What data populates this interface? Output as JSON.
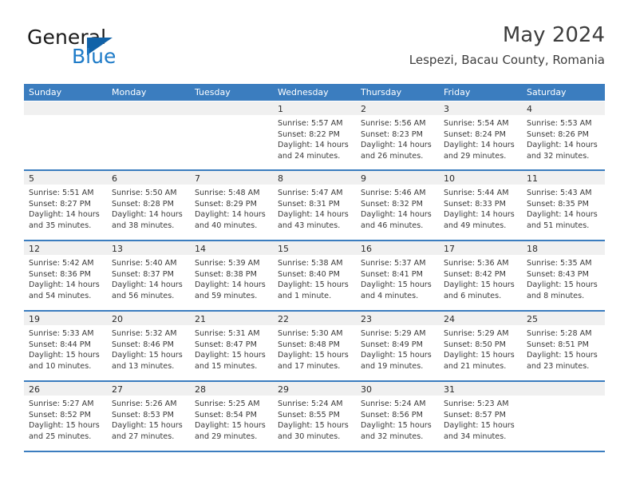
{
  "brand": {
    "name_part1": "General",
    "name_part2": "Blue",
    "accent_color": "#1e7bc8",
    "triangle_color": "#1162a8"
  },
  "header": {
    "title": "May 2024",
    "subtitle": "Lespezi, Bacau County, Romania"
  },
  "theme": {
    "header_bg": "#3b7dbf",
    "header_text": "#ffffff",
    "day_band_bg": "#f0f0f0",
    "cell_bg": "#ffffff",
    "row_divider": "#3b7dbf"
  },
  "weekdays": [
    "Sunday",
    "Monday",
    "Tuesday",
    "Wednesday",
    "Thursday",
    "Friday",
    "Saturday"
  ],
  "labels": {
    "sunrise_prefix": "Sunrise:",
    "sunset_prefix": "Sunset:",
    "daylight_prefix": "Daylight:"
  },
  "weeks": [
    [
      {
        "day": "",
        "l1": "",
        "l2": "",
        "l3": "",
        "l4": ""
      },
      {
        "day": "",
        "l1": "",
        "l2": "",
        "l3": "",
        "l4": ""
      },
      {
        "day": "",
        "l1": "",
        "l2": "",
        "l3": "",
        "l4": ""
      },
      {
        "day": "1",
        "l1": "Sunrise: 5:57 AM",
        "l2": "Sunset: 8:22 PM",
        "l3": "Daylight: 14 hours",
        "l4": "and 24 minutes."
      },
      {
        "day": "2",
        "l1": "Sunrise: 5:56 AM",
        "l2": "Sunset: 8:23 PM",
        "l3": "Daylight: 14 hours",
        "l4": "and 26 minutes."
      },
      {
        "day": "3",
        "l1": "Sunrise: 5:54 AM",
        "l2": "Sunset: 8:24 PM",
        "l3": "Daylight: 14 hours",
        "l4": "and 29 minutes."
      },
      {
        "day": "4",
        "l1": "Sunrise: 5:53 AM",
        "l2": "Sunset: 8:26 PM",
        "l3": "Daylight: 14 hours",
        "l4": "and 32 minutes."
      }
    ],
    [
      {
        "day": "5",
        "l1": "Sunrise: 5:51 AM",
        "l2": "Sunset: 8:27 PM",
        "l3": "Daylight: 14 hours",
        "l4": "and 35 minutes."
      },
      {
        "day": "6",
        "l1": "Sunrise: 5:50 AM",
        "l2": "Sunset: 8:28 PM",
        "l3": "Daylight: 14 hours",
        "l4": "and 38 minutes."
      },
      {
        "day": "7",
        "l1": "Sunrise: 5:48 AM",
        "l2": "Sunset: 8:29 PM",
        "l3": "Daylight: 14 hours",
        "l4": "and 40 minutes."
      },
      {
        "day": "8",
        "l1": "Sunrise: 5:47 AM",
        "l2": "Sunset: 8:31 PM",
        "l3": "Daylight: 14 hours",
        "l4": "and 43 minutes."
      },
      {
        "day": "9",
        "l1": "Sunrise: 5:46 AM",
        "l2": "Sunset: 8:32 PM",
        "l3": "Daylight: 14 hours",
        "l4": "and 46 minutes."
      },
      {
        "day": "10",
        "l1": "Sunrise: 5:44 AM",
        "l2": "Sunset: 8:33 PM",
        "l3": "Daylight: 14 hours",
        "l4": "and 49 minutes."
      },
      {
        "day": "11",
        "l1": "Sunrise: 5:43 AM",
        "l2": "Sunset: 8:35 PM",
        "l3": "Daylight: 14 hours",
        "l4": "and 51 minutes."
      }
    ],
    [
      {
        "day": "12",
        "l1": "Sunrise: 5:42 AM",
        "l2": "Sunset: 8:36 PM",
        "l3": "Daylight: 14 hours",
        "l4": "and 54 minutes."
      },
      {
        "day": "13",
        "l1": "Sunrise: 5:40 AM",
        "l2": "Sunset: 8:37 PM",
        "l3": "Daylight: 14 hours",
        "l4": "and 56 minutes."
      },
      {
        "day": "14",
        "l1": "Sunrise: 5:39 AM",
        "l2": "Sunset: 8:38 PM",
        "l3": "Daylight: 14 hours",
        "l4": "and 59 minutes."
      },
      {
        "day": "15",
        "l1": "Sunrise: 5:38 AM",
        "l2": "Sunset: 8:40 PM",
        "l3": "Daylight: 15 hours",
        "l4": "and 1 minute."
      },
      {
        "day": "16",
        "l1": "Sunrise: 5:37 AM",
        "l2": "Sunset: 8:41 PM",
        "l3": "Daylight: 15 hours",
        "l4": "and 4 minutes."
      },
      {
        "day": "17",
        "l1": "Sunrise: 5:36 AM",
        "l2": "Sunset: 8:42 PM",
        "l3": "Daylight: 15 hours",
        "l4": "and 6 minutes."
      },
      {
        "day": "18",
        "l1": "Sunrise: 5:35 AM",
        "l2": "Sunset: 8:43 PM",
        "l3": "Daylight: 15 hours",
        "l4": "and 8 minutes."
      }
    ],
    [
      {
        "day": "19",
        "l1": "Sunrise: 5:33 AM",
        "l2": "Sunset: 8:44 PM",
        "l3": "Daylight: 15 hours",
        "l4": "and 10 minutes."
      },
      {
        "day": "20",
        "l1": "Sunrise: 5:32 AM",
        "l2": "Sunset: 8:46 PM",
        "l3": "Daylight: 15 hours",
        "l4": "and 13 minutes."
      },
      {
        "day": "21",
        "l1": "Sunrise: 5:31 AM",
        "l2": "Sunset: 8:47 PM",
        "l3": "Daylight: 15 hours",
        "l4": "and 15 minutes."
      },
      {
        "day": "22",
        "l1": "Sunrise: 5:30 AM",
        "l2": "Sunset: 8:48 PM",
        "l3": "Daylight: 15 hours",
        "l4": "and 17 minutes."
      },
      {
        "day": "23",
        "l1": "Sunrise: 5:29 AM",
        "l2": "Sunset: 8:49 PM",
        "l3": "Daylight: 15 hours",
        "l4": "and 19 minutes."
      },
      {
        "day": "24",
        "l1": "Sunrise: 5:29 AM",
        "l2": "Sunset: 8:50 PM",
        "l3": "Daylight: 15 hours",
        "l4": "and 21 minutes."
      },
      {
        "day": "25",
        "l1": "Sunrise: 5:28 AM",
        "l2": "Sunset: 8:51 PM",
        "l3": "Daylight: 15 hours",
        "l4": "and 23 minutes."
      }
    ],
    [
      {
        "day": "26",
        "l1": "Sunrise: 5:27 AM",
        "l2": "Sunset: 8:52 PM",
        "l3": "Daylight: 15 hours",
        "l4": "and 25 minutes."
      },
      {
        "day": "27",
        "l1": "Sunrise: 5:26 AM",
        "l2": "Sunset: 8:53 PM",
        "l3": "Daylight: 15 hours",
        "l4": "and 27 minutes."
      },
      {
        "day": "28",
        "l1": "Sunrise: 5:25 AM",
        "l2": "Sunset: 8:54 PM",
        "l3": "Daylight: 15 hours",
        "l4": "and 29 minutes."
      },
      {
        "day": "29",
        "l1": "Sunrise: 5:24 AM",
        "l2": "Sunset: 8:55 PM",
        "l3": "Daylight: 15 hours",
        "l4": "and 30 minutes."
      },
      {
        "day": "30",
        "l1": "Sunrise: 5:24 AM",
        "l2": "Sunset: 8:56 PM",
        "l3": "Daylight: 15 hours",
        "l4": "and 32 minutes."
      },
      {
        "day": "31",
        "l1": "Sunrise: 5:23 AM",
        "l2": "Sunset: 8:57 PM",
        "l3": "Daylight: 15 hours",
        "l4": "and 34 minutes."
      },
      {
        "day": "",
        "l1": "",
        "l2": "",
        "l3": "",
        "l4": ""
      }
    ]
  ]
}
